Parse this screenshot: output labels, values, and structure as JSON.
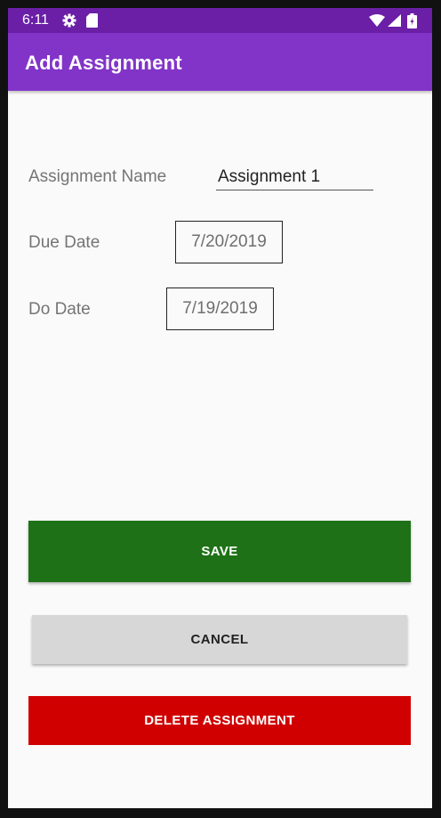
{
  "status_bar": {
    "time": "6:11",
    "icons": [
      "gear-icon",
      "sd-card-icon",
      "wifi-icon",
      "signal-icon",
      "battery-icon"
    ],
    "color": "#6a1fa6"
  },
  "app_bar": {
    "title": "Add Assignment",
    "color": "#8234c8"
  },
  "form": {
    "assignment_name": {
      "label": "Assignment Name",
      "value": "Assignment 1"
    },
    "due_date": {
      "label": "Due Date",
      "value": "7/20/2019"
    },
    "do_date": {
      "label": "Do Date",
      "value": "7/19/2019"
    }
  },
  "buttons": {
    "save": {
      "label": "SAVE",
      "color": "#1e7117"
    },
    "cancel": {
      "label": "CANCEL",
      "color": "#d7d7d7"
    },
    "delete": {
      "label": "DELETE ASSIGNMENT",
      "color": "#d00000"
    }
  }
}
